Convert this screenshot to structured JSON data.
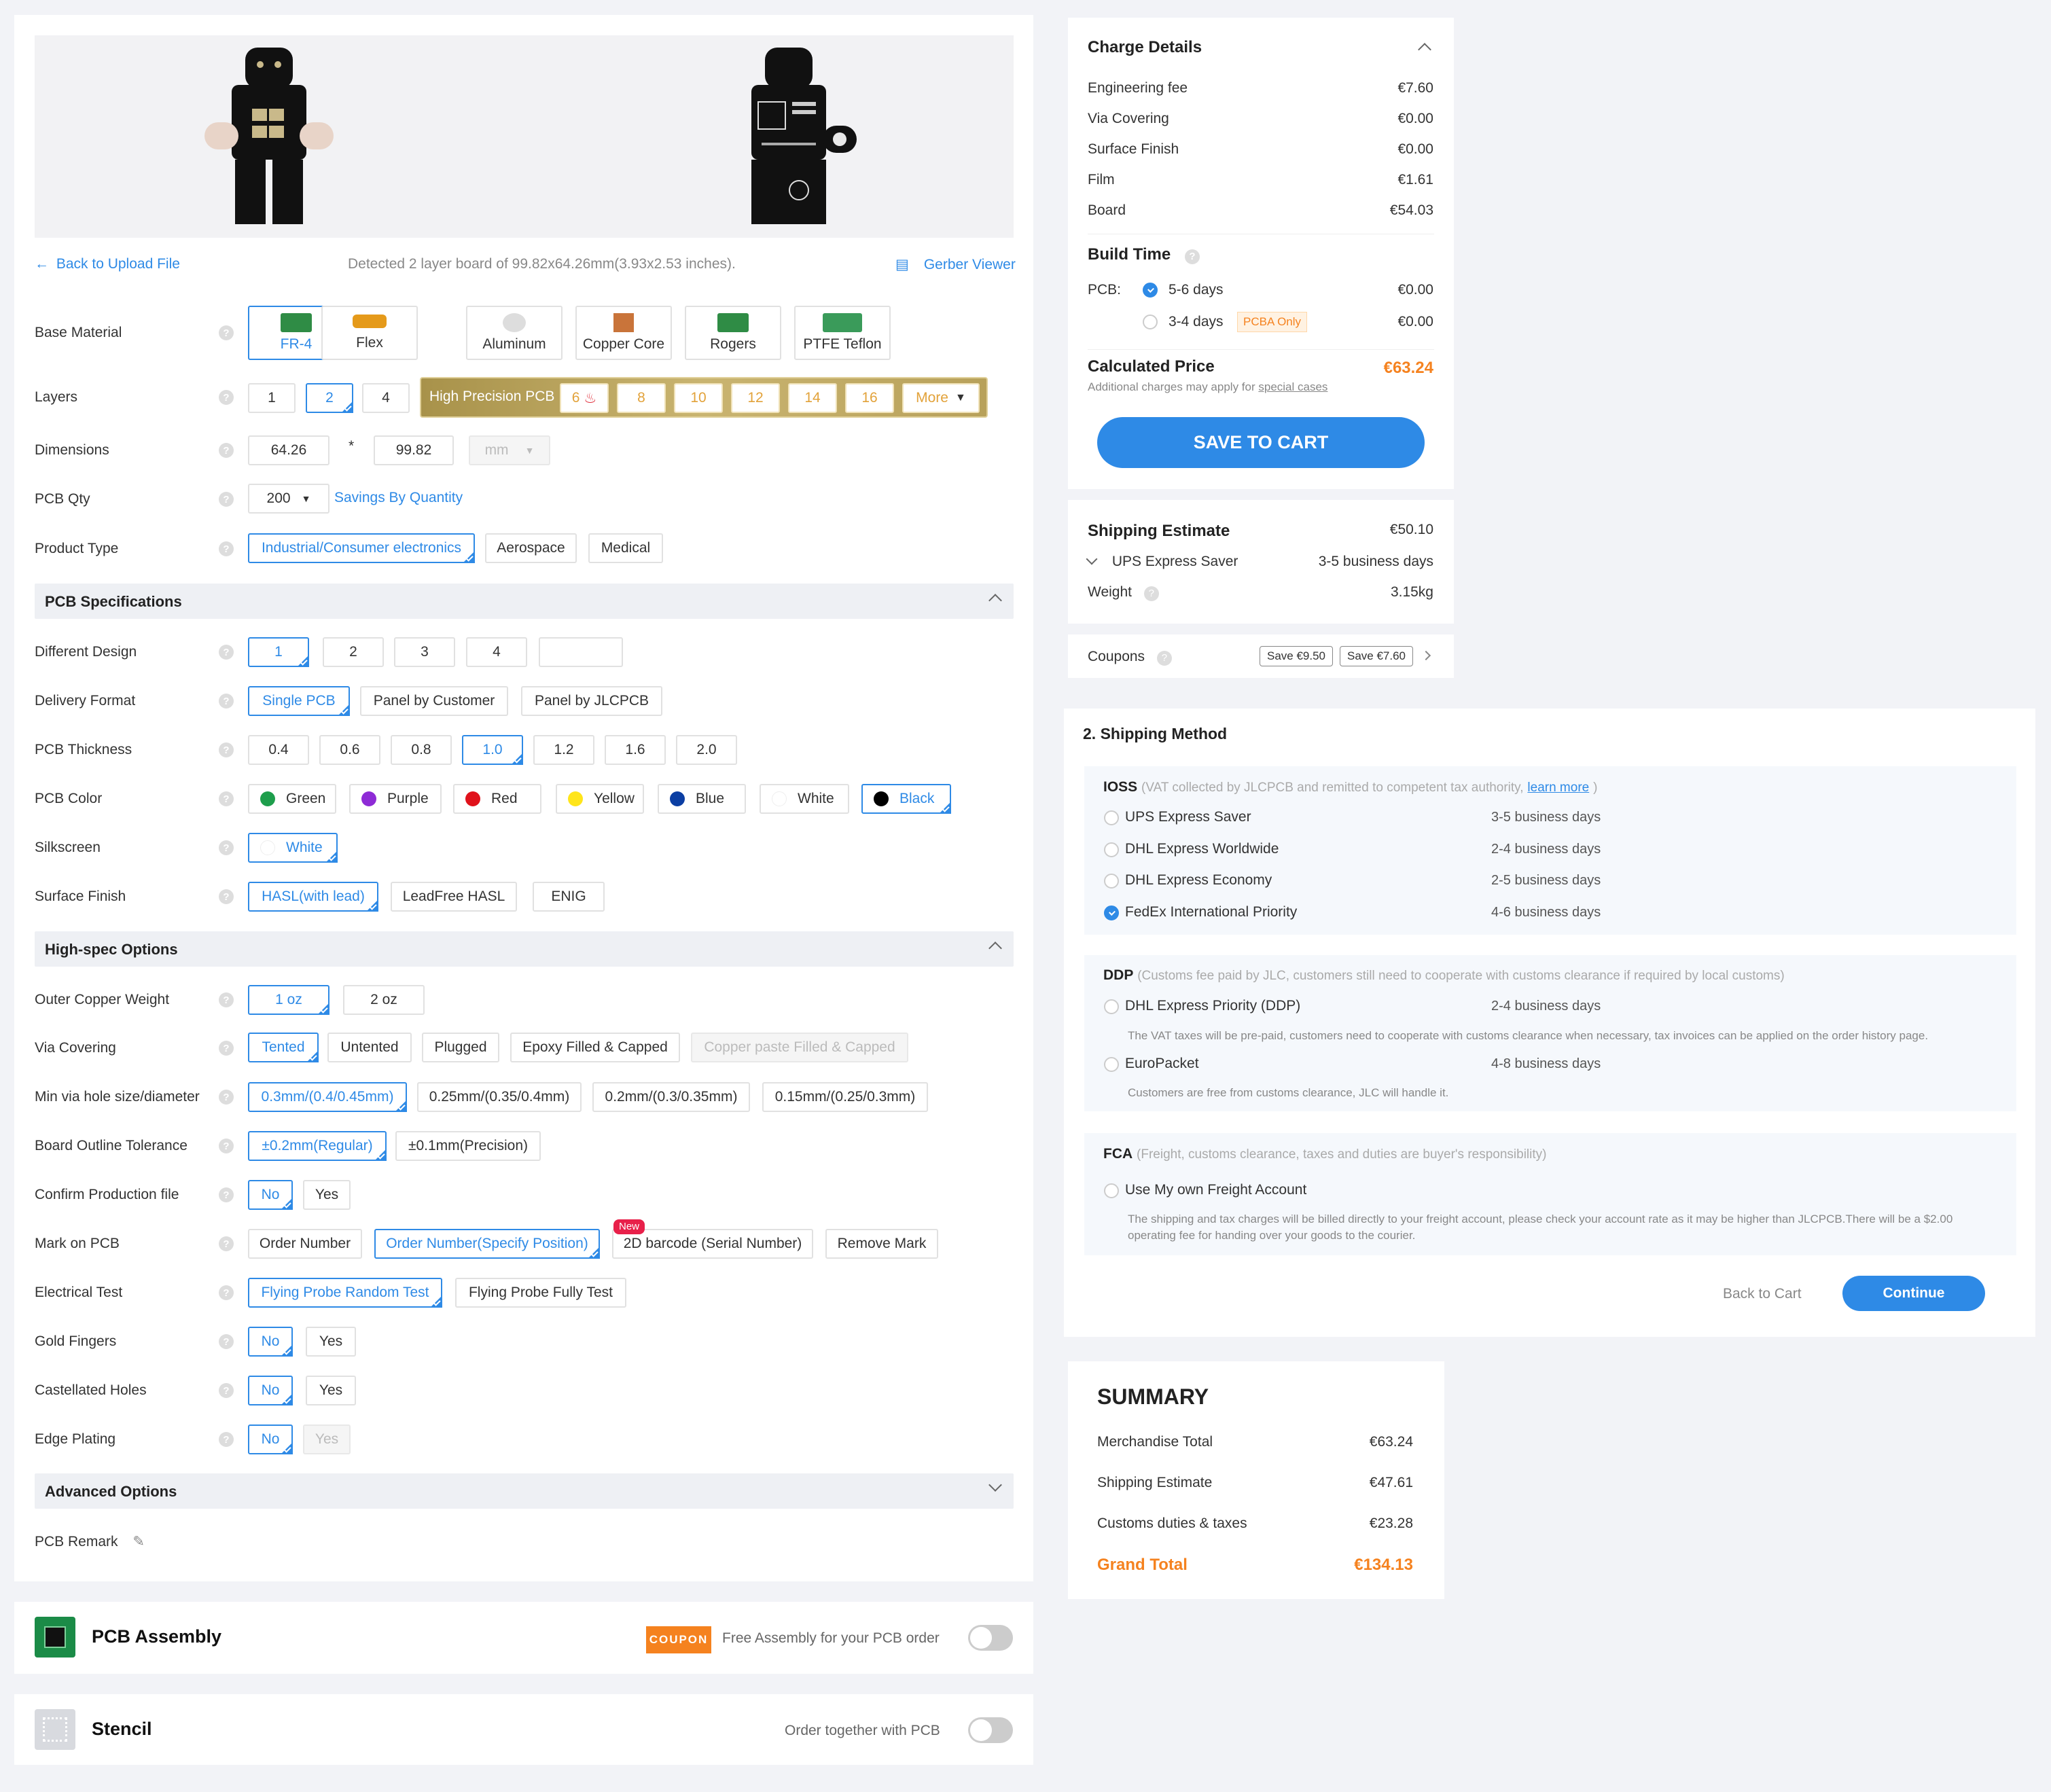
{
  "preview": {
    "back_link": "Back to Upload File",
    "detected": "Detected 2 layer board of 99.82x64.26mm(3.93x2.53 inches).",
    "gerber_viewer": "Gerber Viewer"
  },
  "form": {
    "base_material": {
      "label": "Base Material",
      "options": [
        "FR-4",
        "Flex",
        "Aluminum",
        "Copper Core",
        "Rogers",
        "PTFE Teflon"
      ],
      "selected": "FR-4"
    },
    "layers": {
      "label": "Layers",
      "options": [
        "1",
        "2",
        "4"
      ],
      "selected": "2",
      "hp_label": "High Precision PCB",
      "hp_options": [
        "6",
        "8",
        "10",
        "12",
        "14",
        "16"
      ],
      "more": "More"
    },
    "dimensions": {
      "label": "Dimensions",
      "width": "64.26",
      "sep": "*",
      "height": "99.82",
      "unit": "mm"
    },
    "pcb_qty": {
      "label": "PCB Qty",
      "value": "200",
      "link": "Savings By Quantity"
    },
    "product_type": {
      "label": "Product Type",
      "options": [
        "Industrial/Consumer electronics",
        "Aerospace",
        "Medical"
      ],
      "selected": "Industrial/Consumer electronics"
    },
    "pcb_spec_title": "PCB Specifications",
    "different_design": {
      "label": "Different Design",
      "options": [
        "1",
        "2",
        "3",
        "4",
        ""
      ],
      "selected": "1"
    },
    "delivery_format": {
      "label": "Delivery Format",
      "options": [
        "Single PCB",
        "Panel by Customer",
        "Panel by JLCPCB"
      ],
      "selected": "Single PCB"
    },
    "pcb_thickness": {
      "label": "PCB Thickness",
      "options": [
        "0.4",
        "0.6",
        "0.8",
        "1.0",
        "1.2",
        "1.6",
        "2.0"
      ],
      "selected": "1.0"
    },
    "pcb_color": {
      "label": "PCB Color",
      "options": [
        {
          "name": "Green",
          "color": "#1e9e4c"
        },
        {
          "name": "Purple",
          "color": "#8e2bd6"
        },
        {
          "name": "Red",
          "color": "#e0121b"
        },
        {
          "name": "Yellow",
          "color": "#ffe51a"
        },
        {
          "name": "Blue",
          "color": "#0b3ea3"
        },
        {
          "name": "White",
          "color": "#ffffff"
        },
        {
          "name": "Black",
          "color": "#000000"
        }
      ],
      "selected": "Black"
    },
    "silkscreen": {
      "label": "Silkscreen",
      "value": "White"
    },
    "surface_finish": {
      "label": "Surface Finish",
      "options": [
        "HASL(with lead)",
        "LeadFree HASL",
        "ENIG"
      ],
      "selected": "HASL(with lead)"
    },
    "highspec_title": "High-spec Options",
    "outer_copper": {
      "label": "Outer Copper Weight",
      "options": [
        "1 oz",
        "2 oz"
      ],
      "selected": "1 oz"
    },
    "via_covering": {
      "label": "Via Covering",
      "options": [
        "Tented",
        "Untented",
        "Plugged",
        "Epoxy Filled & Capped",
        "Copper paste Filled & Capped"
      ],
      "selected": "Tented"
    },
    "min_via": {
      "label": "Min via hole size/diameter",
      "options": [
        "0.3mm/(0.4/0.45mm)",
        "0.25mm/(0.35/0.4mm)",
        "0.2mm/(0.3/0.35mm)",
        "0.15mm/(0.25/0.3mm)"
      ],
      "selected": "0.3mm/(0.4/0.45mm)"
    },
    "board_outline": {
      "label": "Board Outline Tolerance",
      "options": [
        "±0.2mm(Regular)",
        "±0.1mm(Precision)"
      ],
      "selected": "±0.2mm(Regular)"
    },
    "confirm_file": {
      "label": "Confirm Production file",
      "options": [
        "No",
        "Yes"
      ],
      "selected": "No"
    },
    "mark_on_pcb": {
      "label": "Mark on PCB",
      "options": [
        "Order Number",
        "Order Number(Specify Position)",
        "2D barcode (Serial Number)",
        "Remove Mark"
      ],
      "selected": "Order Number(Specify Position)",
      "new_badge": "New"
    },
    "electrical_test": {
      "label": "Electrical Test",
      "options": [
        "Flying Probe Random Test",
        "Flying Probe Fully Test"
      ],
      "selected": "Flying Probe Random Test"
    },
    "gold_fingers": {
      "label": "Gold Fingers",
      "options": [
        "No",
        "Yes"
      ],
      "selected": "No"
    },
    "castellated": {
      "label": "Castellated Holes",
      "options": [
        "No",
        "Yes"
      ],
      "selected": "No"
    },
    "edge_plating": {
      "label": "Edge Plating",
      "options": [
        "No",
        "Yes"
      ],
      "selected": "No"
    },
    "advanced_title": "Advanced Options",
    "remark": {
      "label": "PCB Remark"
    }
  },
  "assembly": {
    "title": "PCB Assembly",
    "coupon": "COUPON",
    "text": "Free Assembly for your PCB order"
  },
  "stencil": {
    "title": "Stencil",
    "text": "Order together with PCB"
  },
  "charge": {
    "title": "Charge Details",
    "items": [
      {
        "name": "Engineering fee",
        "value": "€7.60"
      },
      {
        "name": "Via Covering",
        "value": "€0.00"
      },
      {
        "name": "Surface Finish",
        "value": "€0.00"
      },
      {
        "name": "Film",
        "value": "€1.61"
      },
      {
        "name": "Board",
        "value": "€54.03"
      }
    ],
    "build_time": "Build Time",
    "pcb_label": "PCB:",
    "bt1": {
      "label": "5-6 days",
      "value": "€0.00"
    },
    "bt2": {
      "label": "3-4 days",
      "badge": "PCBA Only",
      "value": "€0.00"
    },
    "calc_label": "Calculated Price",
    "calc_value": "€63.24",
    "note_prefix": "Additional charges may apply for",
    "note_link": "special cases",
    "save_btn": "SAVE TO CART"
  },
  "shipping_est": {
    "title": "Shipping Estimate",
    "value": "€50.10",
    "method": "UPS Express Saver",
    "days": "3-5 business days",
    "weight_label": "Weight",
    "weight": "3.15kg"
  },
  "coupons": {
    "label": "Coupons",
    "c1": "Save €9.50",
    "c2": "Save €7.60"
  },
  "shipping_method": {
    "title": "2. Shipping Method",
    "ioss": {
      "title": "IOSS",
      "desc": "(VAT collected by JLCPCB and remitted to competent tax authority,",
      "link": "learn more",
      "close": ")",
      "options": [
        {
          "name": "UPS Express Saver",
          "days": "3-5 business days"
        },
        {
          "name": "DHL Express Worldwide",
          "days": "2-4 business days"
        },
        {
          "name": "DHL Express Economy",
          "days": "2-5 business days"
        },
        {
          "name": "FedEx International Priority",
          "days": "4-6 business days"
        }
      ]
    },
    "ddp": {
      "title": "DDP",
      "desc": "(Customs fee paid by JLC, customers still need to cooperate with customs clearance if required by local customs)",
      "opt1": "DHL Express Priority (DDP)",
      "opt1_days": "2-4 business days",
      "opt1_note": "The VAT taxes will be pre-paid, customers need to cooperate with customs clearance when necessary, tax invoices can be applied on the order history page.",
      "opt2": "EuroPacket",
      "opt2_days": "4-8 business days",
      "opt2_note": "Customers are free from customs clearance, JLC will handle it."
    },
    "fca": {
      "title": "FCA",
      "desc": "(Freight, customs clearance, taxes and duties are buyer's responsibility)",
      "opt": "Use My own Freight Account",
      "note1": "The shipping and tax charges will be billed directly to your freight account, please check your account rate as it may be higher than JLCPCB.There will be a $2.00",
      "note2": "operating fee for handing over your goods to the courier."
    },
    "back": "Back to Cart",
    "continue": "Continue"
  },
  "summary": {
    "title": "SUMMARY",
    "items": [
      {
        "name": "Merchandise Total",
        "value": "€63.24"
      },
      {
        "name": "Shipping Estimate",
        "value": "€47.61"
      },
      {
        "name": "Customs duties & taxes",
        "value": "€23.28"
      }
    ],
    "grand_label": "Grand Total",
    "grand_value": "€134.13"
  },
  "colors": {
    "accent": "#2e8ae6",
    "orange": "#f5821f",
    "gold": "#b8a15a"
  }
}
